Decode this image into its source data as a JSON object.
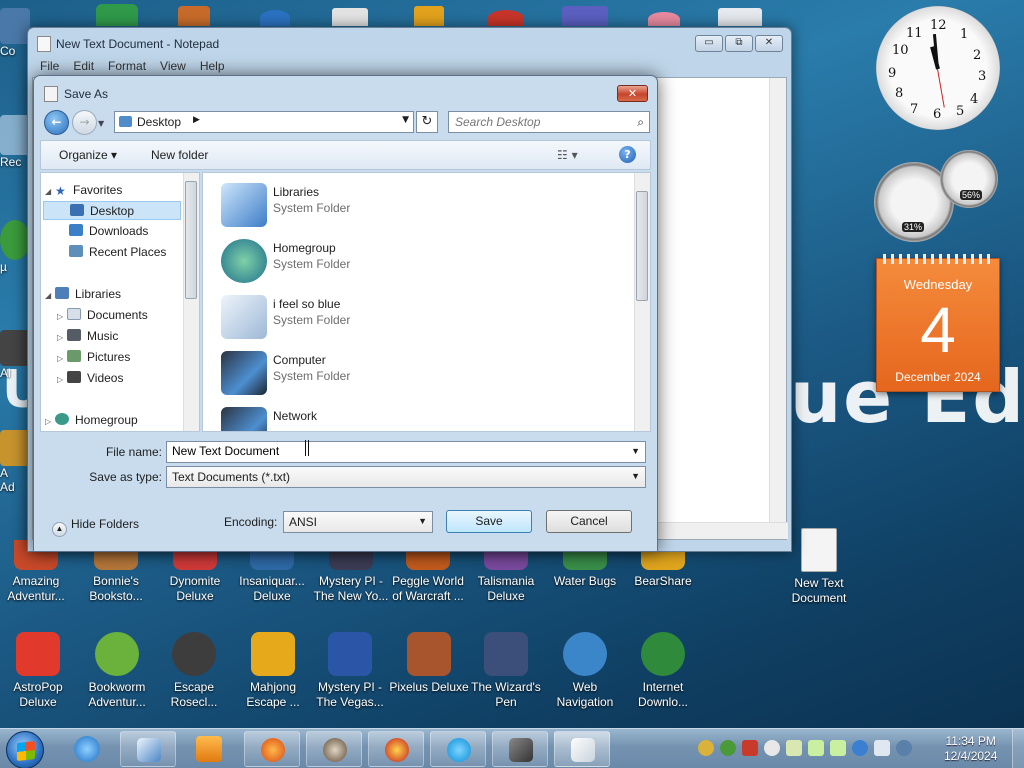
{
  "notepad": {
    "title": "New Text Document - Notepad",
    "menu": [
      "File",
      "Edit",
      "Format",
      "View",
      "Help"
    ],
    "caption_min": "▭",
    "caption_max": "⧉",
    "caption_close": "✕"
  },
  "dialog": {
    "title": "Save As",
    "close": "✕",
    "address": "Desktop",
    "search_placeholder": "Search Desktop",
    "organize": "Organize ▾",
    "new_folder": "New folder",
    "nav": {
      "favorites": "Favorites",
      "desktop": "Desktop",
      "downloads": "Downloads",
      "recent_places": "Recent Places",
      "libraries": "Libraries",
      "documents": "Documents",
      "music": "Music",
      "pictures": "Pictures",
      "videos": "Videos",
      "homegroup": "Homegroup"
    },
    "files": [
      {
        "name": "Libraries",
        "type": "System Folder"
      },
      {
        "name": "Homegroup",
        "type": "System Folder"
      },
      {
        "name": "i feel so blue",
        "type": "System Folder"
      },
      {
        "name": "Computer",
        "type": "System Folder"
      },
      {
        "name": "Network",
        "type": ""
      }
    ],
    "file_name_label": "File name:",
    "file_name_value": "New Text Document",
    "save_type_label": "Save as type:",
    "save_type_value": "Text Documents (*.txt)",
    "hide_folders": "Hide Folders",
    "encoding_label": "Encoding:",
    "encoding_value": "ANSI",
    "save": "Save",
    "cancel": "Cancel"
  },
  "desktop": {
    "row1": [
      {
        "label": "Amazing Adventur...",
        "color": "#c84a2a"
      },
      {
        "label": "Bonnie's Booksto...",
        "color": "#b5773a"
      },
      {
        "label": "Dynomite Deluxe",
        "color": "#d13a3a"
      },
      {
        "label": "Insaniquar... Deluxe",
        "color": "#2f6aa8"
      },
      {
        "label": "Mystery PI - The New Yo...",
        "color": "#3c3c55"
      },
      {
        "label": "Peggle World of Warcraft ...",
        "color": "#c35b1e"
      },
      {
        "label": "Talismania Deluxe",
        "color": "#7a4a9e"
      },
      {
        "label": "Water Bugs",
        "color": "#3a8f4a"
      },
      {
        "label": "BearShare",
        "color": "#e0a51e"
      }
    ],
    "row2": [
      {
        "label": "AstroPop Deluxe",
        "color": "#e2392d"
      },
      {
        "label": "Bookworm Adventur...",
        "color": "#6ab23c"
      },
      {
        "label": "Escape Rosecl...",
        "color": "#3d3d3d"
      },
      {
        "label": "Mahjong Escape ...",
        "color": "#e7a91c"
      },
      {
        "label": "Mystery PI - The Vegas...",
        "color": "#2b56a8"
      },
      {
        "label": "Pixelus Deluxe",
        "color": "#a8552e"
      },
      {
        "label": "The Wizard's Pen",
        "color": "#3c4f7a"
      },
      {
        "label": "Web Navigation",
        "color": "#3a86c9"
      },
      {
        "label": "Internet Downlo...",
        "color": "#2f8a3c"
      }
    ],
    "new_text_doc": "New Text Document",
    "edge_labels": [
      "Co",
      "Rec",
      "µ",
      "Al",
      "Ad",
      "A",
      "Ad"
    ],
    "banner_text": "ue Edition",
    "banner_left": "U"
  },
  "gadgets": {
    "clock_numbers": [
      "12",
      "1",
      "2",
      "3",
      "4",
      "5",
      "6",
      "7",
      "8",
      "9",
      "10",
      "11"
    ],
    "cpu_percent": "31%",
    "mem_percent": "56%",
    "cal_dow": "Wednesday",
    "cal_day": "4",
    "cal_month": "December 2024"
  },
  "taskbar": {
    "time": "11:34 PM",
    "date": "12/4/2024"
  },
  "colors": {
    "accent": "#2a6fbf",
    "calendar": "#e5661e"
  }
}
